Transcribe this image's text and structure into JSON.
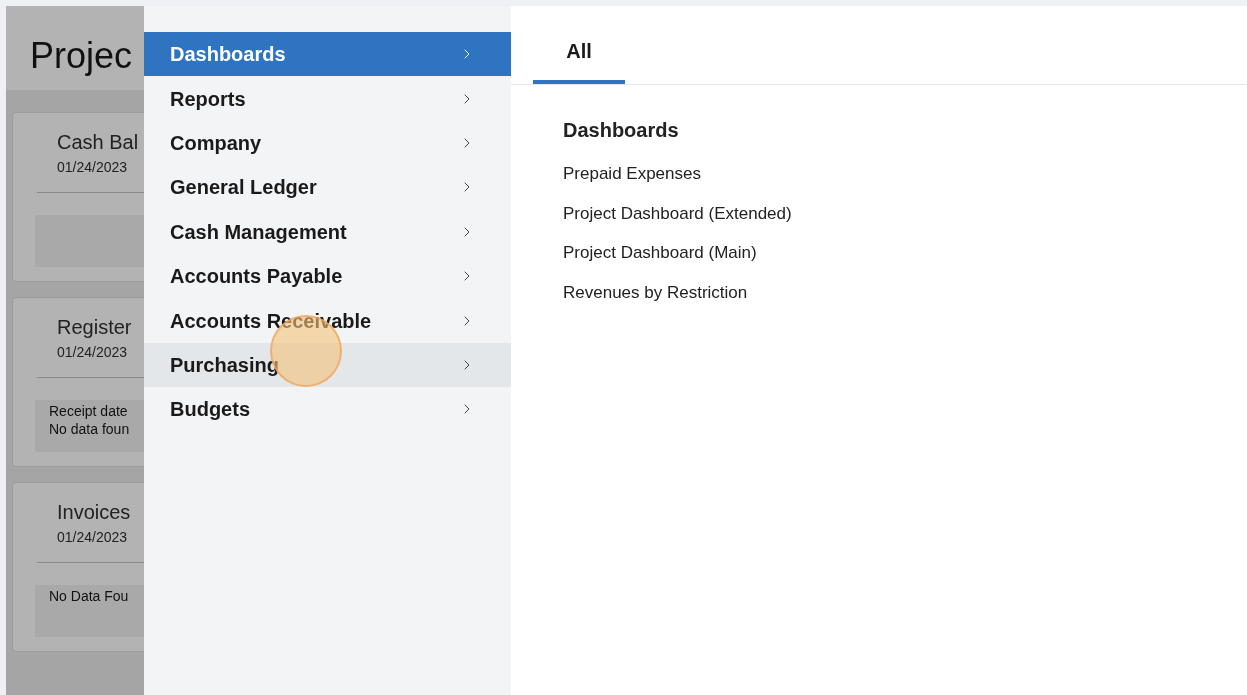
{
  "background": {
    "title": "Projec",
    "cards": [
      {
        "title": "Cash Bal",
        "date": "01/24/2023"
      },
      {
        "title": "Register",
        "date": "01/24/2023",
        "lines": [
          "Receipt date",
          "No data foun"
        ]
      },
      {
        "title": "Invoices",
        "date": "01/24/2023",
        "lines": [
          "No Data Fou"
        ]
      }
    ]
  },
  "menu": [
    {
      "label": "Dashboards",
      "selected": true,
      "hovered": false
    },
    {
      "label": "Reports",
      "selected": false,
      "hovered": false
    },
    {
      "label": "Company",
      "selected": false,
      "hovered": false
    },
    {
      "label": "General Ledger",
      "selected": false,
      "hovered": false
    },
    {
      "label": "Cash Management",
      "selected": false,
      "hovered": false
    },
    {
      "label": "Accounts Payable",
      "selected": false,
      "hovered": false
    },
    {
      "label": "Accounts Receivable",
      "selected": false,
      "hovered": false
    },
    {
      "label": "Purchasing",
      "selected": false,
      "hovered": true
    },
    {
      "label": "Budgets",
      "selected": false,
      "hovered": false
    }
  ],
  "tabs": [
    {
      "label": "All",
      "selected": true
    }
  ],
  "section": {
    "heading": "Dashboards",
    "links": [
      "Prepaid Expenses",
      "Project Dashboard (Extended)",
      "Project Dashboard (Main)",
      "Revenues by Restriction"
    ]
  }
}
